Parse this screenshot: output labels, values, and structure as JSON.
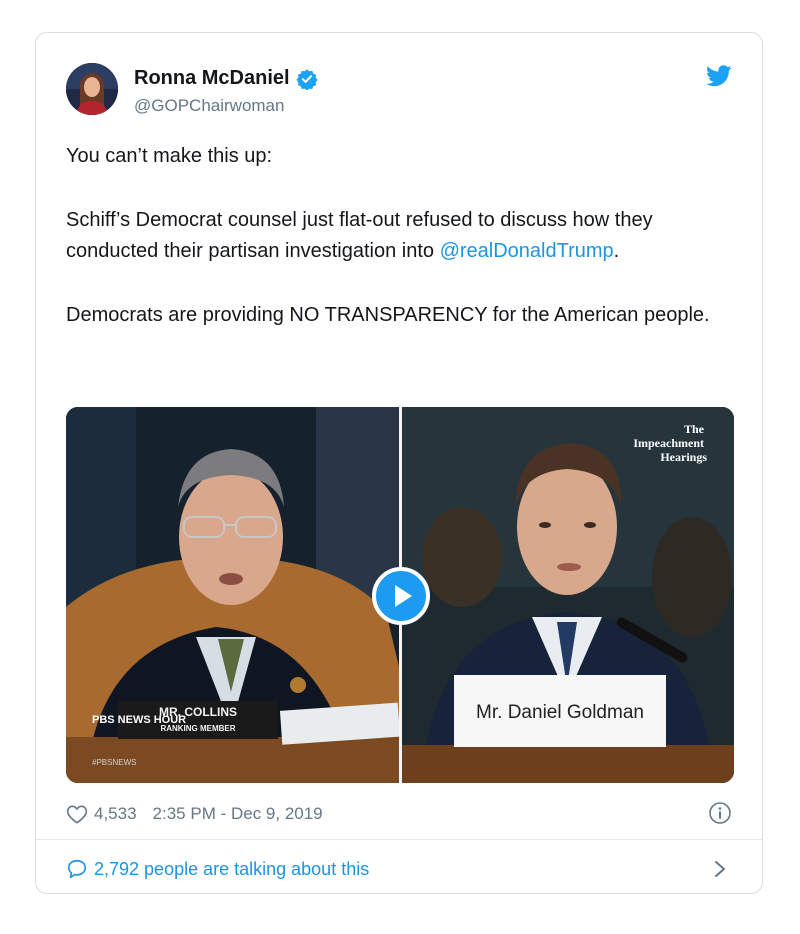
{
  "tweet": {
    "author": {
      "name": "Ronna McDaniel",
      "handle": "@GOPChairwoman"
    },
    "text": {
      "line1": "You can’t make this up:",
      "line2_pre": "Schiff’s Democrat counsel just flat-out refused to discuss how they conducted their partisan investigation into ",
      "mention": "@realDonaldTrump",
      "line2_post": ".",
      "line3": "Democrats are providing NO TRANSPARENCY for the American people."
    },
    "media": {
      "left_nameplate": "MR. COLLINS",
      "left_nameplate_sub": "RANKING MEMBER",
      "pbs_logo": "PBS NEWS HOUR",
      "pbs_tag": "#PBSNEWS",
      "corner_label": "The Impeachment Hearings",
      "right_nameplate": "Mr. Daniel Goldman"
    },
    "stats": {
      "likes": "4,533",
      "timestamp": "2:35 PM - Dec 9, 2019"
    },
    "conversation": "2,792 people are talking about this"
  },
  "icons": {
    "verified": "verified-badge-icon",
    "bird": "twitter-bird-icon",
    "heart": "heart-icon",
    "info": "info-icon",
    "comment": "comment-bubble-icon",
    "chevron": "chevron-right-icon",
    "play": "play-icon"
  },
  "colors": {
    "accent": "#1b95e0",
    "muted": "#657786",
    "text": "#14171a"
  }
}
